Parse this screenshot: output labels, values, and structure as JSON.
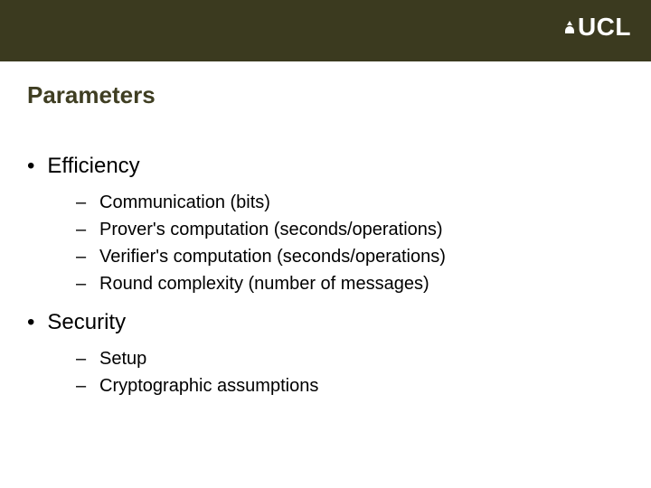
{
  "logo": "UCL",
  "title": "Parameters",
  "bullets": [
    {
      "label": "Efficiency",
      "subitems": [
        "Communication (bits)",
        "Prover's computation (seconds/operations)",
        "Verifier's computation (seconds/operations)",
        "Round complexity (number of messages)"
      ]
    },
    {
      "label": "Security",
      "subitems": [
        "Setup",
        "Cryptographic assumptions"
      ]
    }
  ]
}
